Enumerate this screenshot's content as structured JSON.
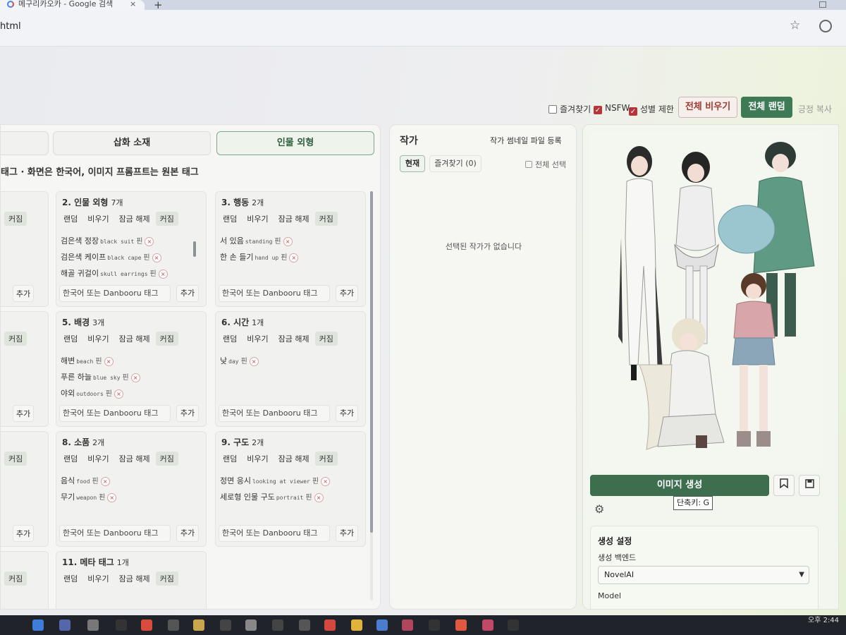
{
  "browser": {
    "tab_title": "메구리카오카 - Google 검색",
    "tab_close": "×",
    "new_tab": "+",
    "url": "html"
  },
  "toolbar": {
    "favorites_label": "즐겨찾기",
    "nsfw_label": "NSFW",
    "gender_label": "성별 제한",
    "clear_all": "전체 비우기",
    "random_all": "전체 랜덤",
    "copy_label": "긍정 복사"
  },
  "mode_tabs": {
    "illustration": "삽화 소재",
    "appearance": "인물 외형"
  },
  "hint": "태그 · 화면은 한국어, 이미지 프롬프트는 원본 태그",
  "actions": {
    "random": "랜덤",
    "clear": "비우기",
    "unlock": "잠금 해제",
    "big": "커짐",
    "add": "추가",
    "placeholder": "한국어 또는 Danbooru 태그",
    "pin": "핀",
    "remove": "×"
  },
  "categories": [
    {
      "title": "2. 인물 외형",
      "count": "7개",
      "tags": [
        {
          "ko": "검은색 정장",
          "en": "black suit"
        },
        {
          "ko": "검은색 케이프",
          "en": "black cape"
        },
        {
          "ko": "해골 귀걸이",
          "en": "skull earrings"
        }
      ]
    },
    {
      "title": "3. 행동",
      "count": "2개",
      "tags": [
        {
          "ko": "서 있음",
          "en": "standing"
        },
        {
          "ko": "한 손 들기",
          "en": "hand up"
        }
      ]
    },
    {
      "title": "5. 배경",
      "count": "3개",
      "tags": [
        {
          "ko": "해변",
          "en": "beach"
        },
        {
          "ko": "푸른 하늘",
          "en": "blue sky"
        },
        {
          "ko": "야외",
          "en": "outdoors"
        }
      ]
    },
    {
      "title": "6. 시간",
      "count": "1개",
      "tags": [
        {
          "ko": "낮",
          "en": "day"
        }
      ]
    },
    {
      "title": "8. 소품",
      "count": "2개",
      "tags": [
        {
          "ko": "음식",
          "en": "food"
        },
        {
          "ko": "무기",
          "en": "weapon"
        }
      ]
    },
    {
      "title": "9. 구도",
      "count": "2개",
      "tags": [
        {
          "ko": "정면 응시",
          "en": "looking at viewer"
        },
        {
          "ko": "세로형 인물 구도",
          "en": "portrait"
        }
      ]
    },
    {
      "title": "11. 메타 태그",
      "count": "1개",
      "tags": []
    }
  ],
  "artist": {
    "title": "작가",
    "register": "작가 썸네일 파일 등록",
    "tab_current": "현재",
    "tab_favorites": "즐겨찾기 (0)",
    "select_all": "전체 선택",
    "empty": "선택된 작가가 없습니다"
  },
  "generate": {
    "button": "이미지 생성",
    "tooltip": "단축키: G",
    "bookmark_icon": "bookmark-icon",
    "save_icon": "floppy-icon"
  },
  "settings": {
    "title": "생성 설정",
    "backend_label": "생성 백엔드",
    "backend_value": "NovelAI",
    "model_label": "Model"
  },
  "taskbar": {
    "time": "오후 2:44"
  },
  "colors": {
    "accent_green": "#3d7a55",
    "danger": "#9b3b33",
    "checkbox_red": "#b5353a"
  }
}
